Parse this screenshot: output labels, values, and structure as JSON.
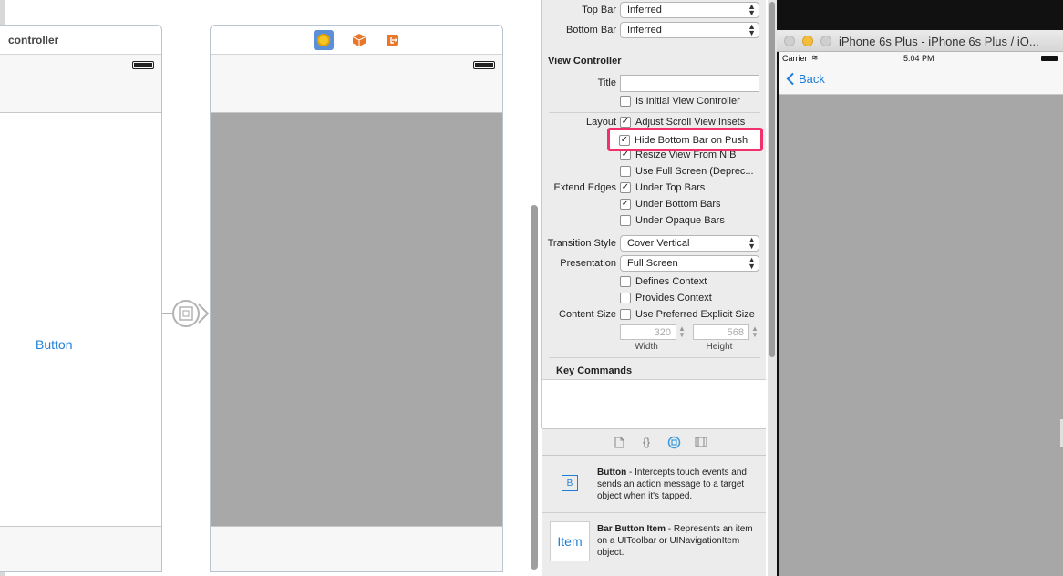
{
  "canvas": {
    "scene1": {
      "title": "controller",
      "button_label": "Button"
    },
    "scene2": {
      "icons": [
        "view-controller-icon",
        "first-responder-icon",
        "exit-icon"
      ]
    },
    "segue_icon": "navigation-segue-icon"
  },
  "inspector": {
    "top_bar": {
      "label": "Top Bar",
      "value": "Inferred"
    },
    "bottom_bar": {
      "label": "Bottom Bar",
      "value": "Inferred"
    },
    "view_controller": {
      "section_title": "View Controller",
      "title_label": "Title",
      "title_value": "",
      "is_initial": {
        "label": "Is Initial View Controller",
        "checked": false
      },
      "layout_label": "Layout",
      "layout": [
        {
          "label": "Adjust Scroll View Insets",
          "checked": true
        },
        {
          "label": "Hide Bottom Bar on Push",
          "checked": true
        },
        {
          "label": "Resize View From NIB",
          "checked": true
        },
        {
          "label": "Use Full Screen (Deprec...",
          "checked": false
        }
      ],
      "extend_edges_label": "Extend Edges",
      "extend_edges": [
        {
          "label": "Under Top Bars",
          "checked": true
        },
        {
          "label": "Under Bottom Bars",
          "checked": true
        },
        {
          "label": "Under Opaque Bars",
          "checked": false
        }
      ],
      "transition_style": {
        "label": "Transition Style",
        "value": "Cover Vertical"
      },
      "presentation": {
        "label": "Presentation",
        "value": "Full Screen"
      },
      "defines_context": {
        "label": "Defines Context",
        "checked": false
      },
      "provides_context": {
        "label": "Provides Context",
        "checked": false
      },
      "content_size": {
        "label": "Content Size",
        "checkbox_label": "Use Preferred Explicit Size",
        "checked": false,
        "width": "320",
        "height": "568",
        "width_label": "Width",
        "height_label": "Height"
      }
    },
    "key_commands": {
      "section_title": "Key Commands"
    }
  },
  "library_tabs": [
    "file-template-icon",
    "code-snippet-icon",
    "object-library-icon",
    "media-library-icon"
  ],
  "library": [
    {
      "thumb": "B",
      "name": "Button",
      "description": " - Intercepts touch events and sends an action message to a target object when it's tapped."
    },
    {
      "thumb": "Item",
      "name": "Bar Button Item",
      "description": " - Represents an item on a UIToolbar or UINavigationItem object."
    }
  ],
  "simulator": {
    "window_title": "iPhone 6s Plus - iPhone 6s Plus / iO...",
    "carrier": "Carrier",
    "time": "5:04 PM",
    "back_label": "Back"
  },
  "colors": {
    "accent": "#1f7fd6",
    "highlight": "#f2316c",
    "scene_gray": "#a8a8a8"
  }
}
